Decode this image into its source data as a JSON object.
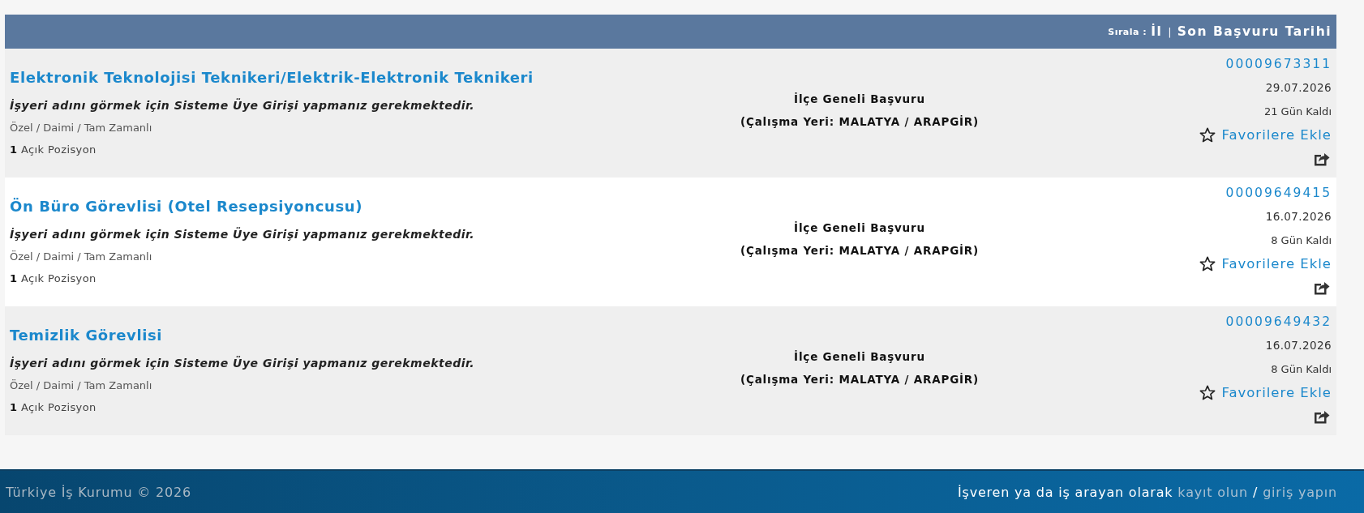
{
  "sort_bar": {
    "label": "Sırala :",
    "options": [
      {
        "label": "İl"
      },
      {
        "label": "Son Başvuru Tarihi"
      }
    ],
    "separator": "|"
  },
  "listings": [
    {
      "title": "Elektronik Teknolojisi Teknikeri/Elektrik-Elektronik Teknikeri",
      "employer_notice": "İşyeri adını görmek için Sisteme Üye Girişi yapmanız gerekmektedir.",
      "employment_type": "Özel / Daimi / Tam Zamanlı",
      "open_positions": "**1** Açık Pozisyon",
      "application_scope": "İlçe Geneli Başvuru",
      "location": "(Çalışma Yeri: MALATYA / ARAPGİR)",
      "listing_number": "00009673311",
      "deadline": "29.07.2026",
      "days_left": "21 Gün Kaldı",
      "favorite_label": "Favorilere Ekle"
    },
    {
      "title": "Ön Büro Görevlisi (Otel Resepsiyoncusu)",
      "employer_notice": "İşyeri adını görmek için Sisteme Üye Girişi yapmanız gerekmektedir.",
      "employment_type": "Özel / Daimi / Tam Zamanlı",
      "open_positions": "**1** Açık Pozisyon",
      "application_scope": "İlçe Geneli Başvuru",
      "location": "(Çalışma Yeri: MALATYA / ARAPGİR)",
      "listing_number": "00009649415",
      "deadline": "16.07.2026",
      "days_left": "8 Gün Kaldı",
      "favorite_label": "Favorilere Ekle"
    },
    {
      "title": "Temizlik Görevlisi",
      "employer_notice": "İşyeri adını görmek için Sisteme Üye Girişi yapmanız gerekmektedir.",
      "employment_type": "Özel / Daimi / Tam Zamanlı",
      "open_positions": "**1** Açık Pozisyon",
      "application_scope": "İlçe Geneli Başvuru",
      "location": "(Çalışma Yeri: MALATYA / ARAPGİR)",
      "listing_number": "00009649432",
      "deadline": "16.07.2026",
      "days_left": "8 Gün Kaldı",
      "favorite_label": "Favorilere Ekle"
    }
  ],
  "footer": {
    "copyright": "Türkiye İş Kurumu © 2026",
    "prompt": "İşveren ya da iş arayan olarak",
    "register_link": "kayıt olun",
    "separator": "/",
    "login_link": "giriş yapın"
  }
}
